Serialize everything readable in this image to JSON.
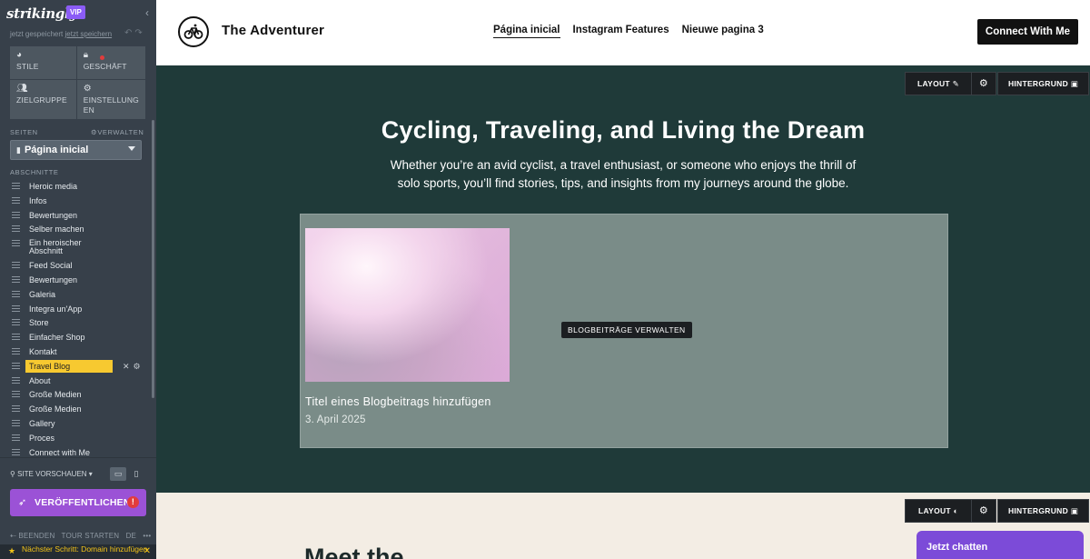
{
  "sidebar": {
    "logo": "strikingly",
    "vip": "VIP",
    "saved_text": "jetzt gespeichert",
    "save_link": "jetzt speichern",
    "tiles": [
      {
        "label": "STILE",
        "icon": "palette-icon"
      },
      {
        "label": "GESCHÄFT",
        "icon": "lock-icon"
      },
      {
        "label": "ZIELGRUPPE",
        "icon": "people-icon"
      },
      {
        "label": "EINSTELLUNG EN",
        "icon": "gear-icon"
      }
    ],
    "pages_header": "SEITEN",
    "manage": "VERWALTEN",
    "current_page": "Página inicial",
    "sections_header": "ABSCHNITTE",
    "sections": [
      "Heroic media",
      "Infos",
      "Bewertungen",
      "Selber machen",
      "Ein heroischer Abschnitt",
      "Feed Social",
      "Bewertungen",
      "Galeria",
      "Integra un'App",
      "Store",
      "Einfacher Shop",
      "Kontakt",
      "Travel Blog",
      "About",
      "Große Medien",
      "Große Medien",
      "Gallery",
      "Proces",
      "Connect with Me"
    ],
    "active_section": "Travel Blog",
    "preview": "SITE VORSCHAUEN",
    "publish": "VERÖFFENTLICHEN",
    "publish_alert": "!",
    "quit": "BEENDEN",
    "tour": "TOUR STARTEN",
    "lang": "DE",
    "next_step": "Nächster Schritt: Domain hinzufügen"
  },
  "nav": {
    "brand": "The Adventurer",
    "links": [
      "Página inicial",
      "Instagram Features",
      "Nieuwe pagina 3"
    ],
    "cta": "Connect With Me"
  },
  "hero": {
    "layout_btn": "LAYOUT",
    "background_btn": "HINTERGRUND",
    "title": "Cycling, Traveling, and Living the Dream",
    "subtitle": "Whether you’re an avid cyclist, a travel enthusiast, or someone who enjoys the thrill of solo sports, you’ll find stories, tips, and insights from my journeys around the globe.",
    "manage_posts": "BLOGBEITRÄGE VERWALTEN",
    "post_title": "Titel eines Blogbeitrags hinzufügen",
    "post_date": "3. April 2025"
  },
  "about": {
    "layout_btn": "LAYOUT",
    "background_btn": "HINTERGRUND",
    "heading": "Meet the",
    "chat": "Jetzt chatten"
  }
}
